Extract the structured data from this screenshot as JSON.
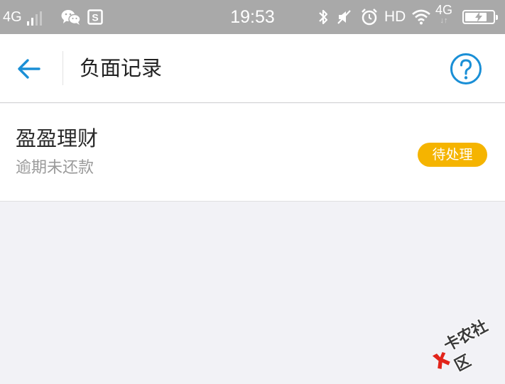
{
  "status_bar": {
    "network_left": "4G",
    "time": "19:53",
    "hd": "HD",
    "network_right": "4G",
    "network_arrows": "↓↑",
    "battery_level": 0.8
  },
  "nav": {
    "title": "负面记录",
    "accent_color": "#1a8fd6"
  },
  "record": {
    "name": "盈盈理财",
    "description": "逾期未还款",
    "status": "待处理",
    "status_color": "#f5b400"
  },
  "watermark": {
    "text": "卡农社区"
  }
}
